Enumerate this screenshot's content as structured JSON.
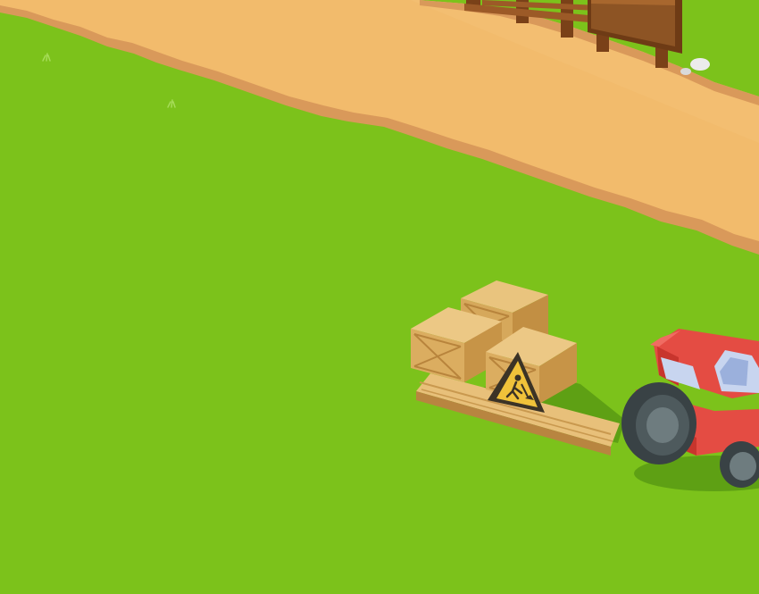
{
  "scene": {
    "type": "farm-game-world",
    "elements": [
      "grass-field",
      "dirt-road",
      "wooden-fence",
      "wooden-signboard",
      "pebbles",
      "wooden-crates",
      "wooden-planks",
      "construction-warning-sign",
      "red-tractor"
    ]
  },
  "colors": {
    "grass": "#7cc21b",
    "road": "#f2bb6c",
    "road_edge": "#d9995a",
    "fence": "#8a4f22",
    "crate": "#dcae63",
    "sign": "#f0c23a",
    "tractor": "#e44c43",
    "tire": "#4a5558"
  },
  "icons": {
    "construction_sign": "worker-digging-icon"
  }
}
